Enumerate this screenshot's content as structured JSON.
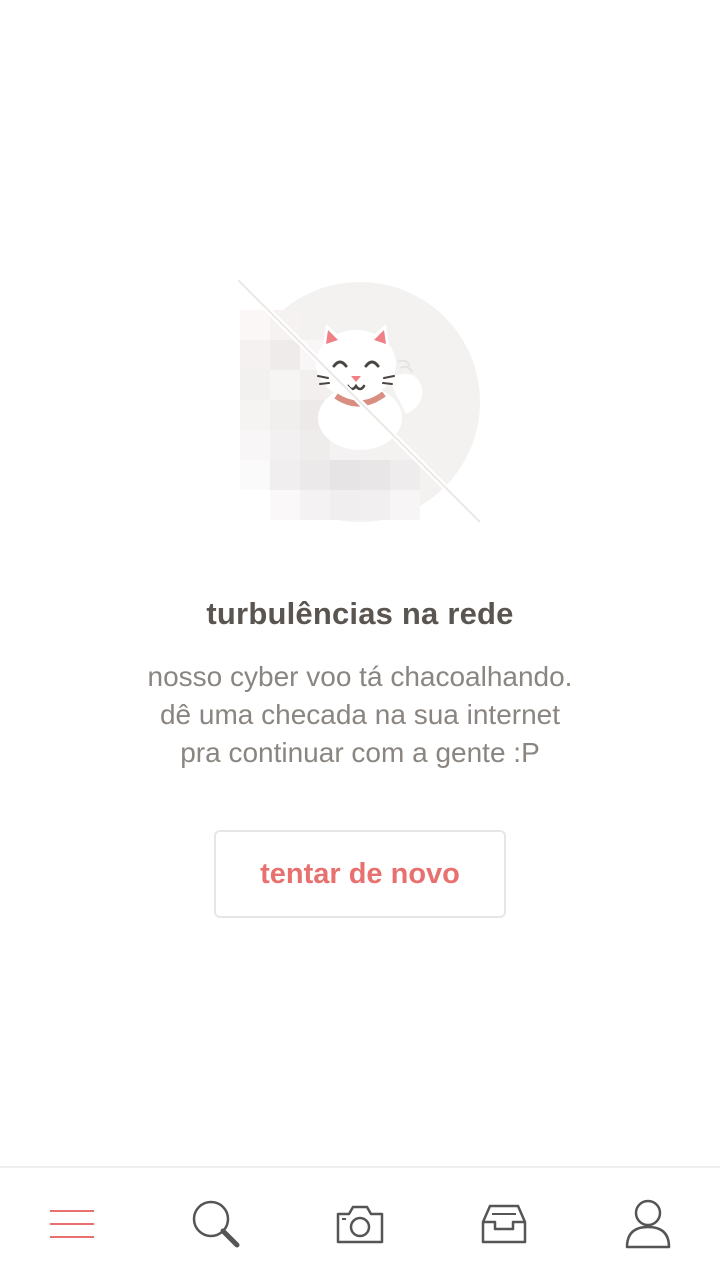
{
  "error": {
    "illustration_icon": "offline-lucky-cat-illustration",
    "title": "turbulências na rede",
    "message_lines": [
      "nosso cyber voo tá chacoalhando.",
      "dê uma checada na sua internet",
      "pra continuar com a gente :P"
    ],
    "retry_label": "tentar de novo"
  },
  "tab_bar": {
    "items": [
      {
        "icon": "menu-icon",
        "active": true
      },
      {
        "icon": "search-icon",
        "active": false
      },
      {
        "icon": "camera-icon",
        "active": false
      },
      {
        "icon": "inbox-icon",
        "active": false
      },
      {
        "icon": "profile-icon",
        "active": false
      }
    ]
  },
  "colors": {
    "accent": "#e8706f",
    "title_text": "#5a5550",
    "body_text": "#8a8580",
    "icon_inactive": "#555555",
    "button_border": "#e6e6e6"
  }
}
